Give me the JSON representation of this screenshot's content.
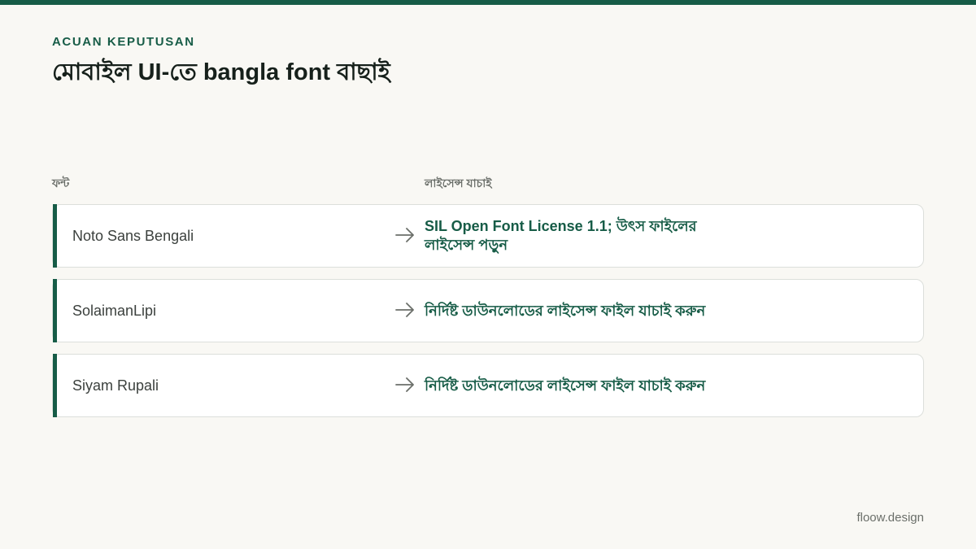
{
  "colors": {
    "accent": "#175c47",
    "background": "#f9f8f4",
    "card": "#ffffff"
  },
  "header": {
    "eyebrow": "ACUAN KEPUTUSAN",
    "title": "মোবাইল UI-তে bangla font বাছাই"
  },
  "table": {
    "columns": {
      "font": "ফন্ট",
      "license": "লাইসেন্স যাচাই"
    },
    "rows": [
      {
        "font": "Noto Sans Bengali",
        "license": "SIL Open Font License 1.1; উৎস ফাইলের লাইসেন্স পড়ুন"
      },
      {
        "font": "SolaimanLipi",
        "license": "নির্দিষ্ট ডাউনলোডের লাইসেন্স ফাইল যাচাই করুন"
      },
      {
        "font": "Siyam Rupali",
        "license": "নির্দিষ্ট ডাউনলোডের লাইসেন্স ফাইল যাচাই করুন"
      }
    ],
    "arrow_icon": "arrow-right-icon"
  },
  "footer": {
    "brand": "floow.design"
  }
}
